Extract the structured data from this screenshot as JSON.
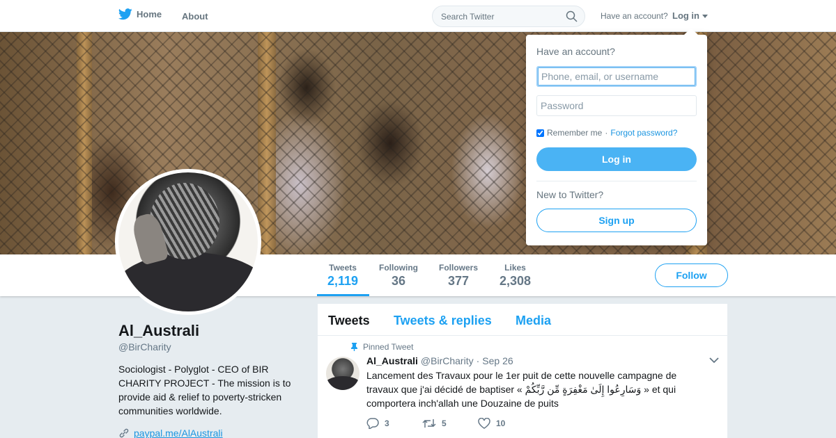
{
  "nav": {
    "home_label": "Home",
    "about_label": "About",
    "search_placeholder": "Search Twitter",
    "have_account": "Have an account?",
    "login_label": "Log in"
  },
  "profile": {
    "name": "Al_Australi",
    "handle": "@BirCharity",
    "bio": "Sociologist - Polyglot - CEO of BIR CHARITY PROJECT - The mission is to provide aid & relief to poverty-stricken communities worldwide.",
    "link": "paypal.me/AlAustrali",
    "follow_label": "Follow"
  },
  "stats": [
    {
      "label": "Tweets",
      "value": "2,119",
      "active": true
    },
    {
      "label": "Following",
      "value": "36"
    },
    {
      "label": "Followers",
      "value": "377"
    },
    {
      "label": "Likes",
      "value": "2,308"
    }
  ],
  "timeline": {
    "tabs": [
      "Tweets",
      "Tweets & replies",
      "Media"
    ],
    "pinned_label": "Pinned Tweet",
    "tweet": {
      "name": "Al_Australi",
      "handle": "@BirCharity",
      "sep": "·",
      "date": "Sep 26",
      "text": "Lancement des Travaux pour le 1er puit de cette nouvelle campagne de travaux que j'ai décidé de baptiser « وَسَارِعُوا إِلَىٰ مَغْفِرَةٍ مِّن رَّبِّكُمْ » et qui comportera inch'allah une Douzaine de puits",
      "replies": "3",
      "retweets": "5",
      "likes": "10"
    }
  },
  "login_dropdown": {
    "title": "Have an account?",
    "username_placeholder": "Phone, email, or username",
    "password_placeholder": "Password",
    "remember_label": "Remember me",
    "dot": "·",
    "forgot_label": "Forgot password?",
    "login_button": "Log in",
    "new_label": "New to Twitter?",
    "signup_button": "Sign up"
  },
  "colors": {
    "brand": "#1da1f2",
    "login_button": "#4ab3f4",
    "muted_text": "#657786"
  }
}
